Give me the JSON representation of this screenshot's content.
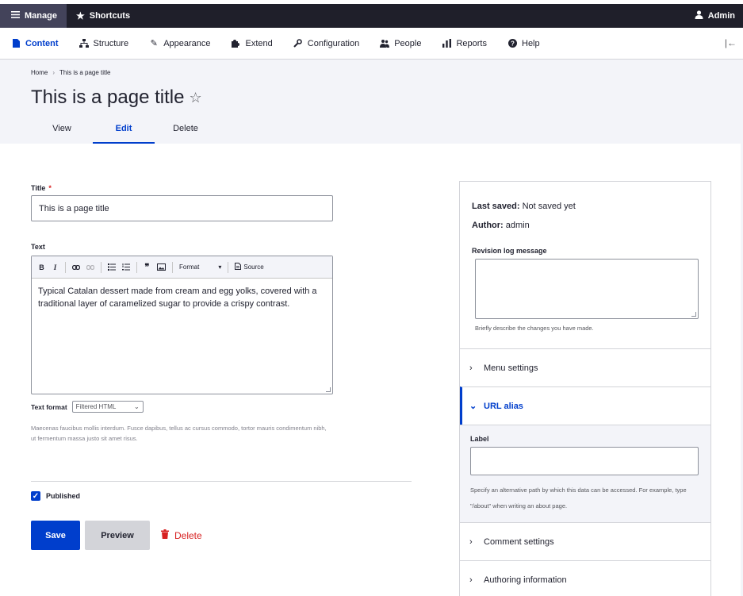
{
  "toolbar": {
    "manage": "Manage",
    "shortcuts": "Shortcuts",
    "user": "Admin"
  },
  "tray": {
    "items": [
      {
        "label": "Content",
        "icon": "file-icon"
      },
      {
        "label": "Structure",
        "icon": "sitemap-icon"
      },
      {
        "label": "Appearance",
        "icon": "paintbrush-icon"
      },
      {
        "label": "Extend",
        "icon": "puzzle-icon"
      },
      {
        "label": "Configuration",
        "icon": "wrench-icon"
      },
      {
        "label": "People",
        "icon": "people-icon"
      },
      {
        "label": "Reports",
        "icon": "bar-chart-icon"
      },
      {
        "label": "Help",
        "icon": "help-icon"
      }
    ],
    "active": "Content"
  },
  "breadcrumb": {
    "home": "Home",
    "sep": "›",
    "current": "This is a page title"
  },
  "page": {
    "title": "This is a page title"
  },
  "tabs": [
    "View",
    "Edit",
    "Delete"
  ],
  "form": {
    "title_label": "Title",
    "required_mark": "*",
    "title_value": "This is a page title",
    "text_label": "Text",
    "editor": {
      "bold": "B",
      "italic": "I",
      "quote": "❞",
      "format": "Format",
      "source": "Source",
      "body": "Typical Catalan dessert made from cream and egg yolks, covered with a traditional layer of caramelized sugar to provide a crispy contrast."
    },
    "text_format_label": "Text format",
    "text_format_value": "Filtered HTML",
    "help_text": "Maecenas faucibus mollis interdum. Fusce dapibus, tellus ac cursus commodo, tortor mauris condimentum nibh, ut fermentum massa justo sit amet risus.",
    "published_label": "Published",
    "published": true,
    "save": "Save",
    "preview": "Preview",
    "delete": "Delete"
  },
  "sidebar": {
    "last_saved_label": "Last saved:",
    "last_saved_value": "Not saved yet",
    "author_label": "Author:",
    "author_value": "admin",
    "revision_label": "Revision log message",
    "revision_help": "Briefly describe the changes you have made.",
    "sections": {
      "menu": "Menu settings",
      "url": "URL alias",
      "comment": "Comment settings",
      "authoring": "Authoring information"
    },
    "url_label": "Label",
    "url_help": "Specify an alternative path by which this data can be accessed. For example, type \"/about\" when writing an about page."
  },
  "colors": {
    "accent": "#003ecc",
    "danger": "#d72222",
    "toolbar_bg": "#1f1f2a",
    "header_bg": "#f3f4f9"
  }
}
